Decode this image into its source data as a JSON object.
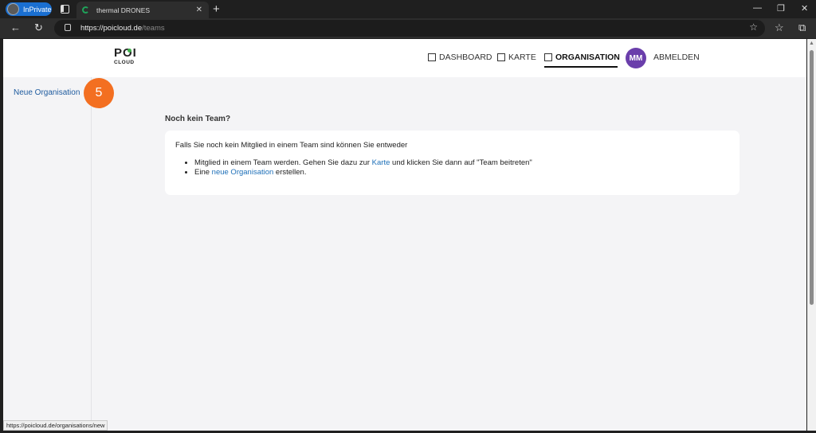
{
  "browser": {
    "inprivate_label": "InPrivate",
    "tab_title": "thermal DRONES",
    "url_host": "https://poicloud.de",
    "url_path": "/teams",
    "status_url": "https://poicloud.de/organisations/new"
  },
  "header": {
    "logo_top": "POI",
    "logo_bottom": "CLOUD",
    "nav": [
      {
        "label": "DASHBOARD",
        "icon": "dashboard-icon"
      },
      {
        "label": "KARTE",
        "icon": "map-icon"
      },
      {
        "label": "ORGANISATION",
        "icon": "organisation-icon",
        "active": true
      },
      {
        "label": "ABMELDEN"
      }
    ],
    "user_initials": "MM"
  },
  "sidebar": {
    "new_org_link": "Neue Organisation",
    "badge_number": "5"
  },
  "main": {
    "title": "Noch kein Team?",
    "intro": "Falls Sie noch kein Mitglied in einem Team sind können Sie entweder",
    "item1_pre": "Mitglied in einem Team werden. Gehen Sie dazu zur ",
    "item1_link": "Karte",
    "item1_post": " und klicken Sie dann auf \"Team beitreten\"",
    "item2_pre": "Eine ",
    "item2_link": "neue Organisation",
    "item2_post": " erstellen."
  },
  "colors": {
    "accent": "#6a3eab",
    "badge": "#f36f21",
    "link": "#1d6fb8"
  }
}
